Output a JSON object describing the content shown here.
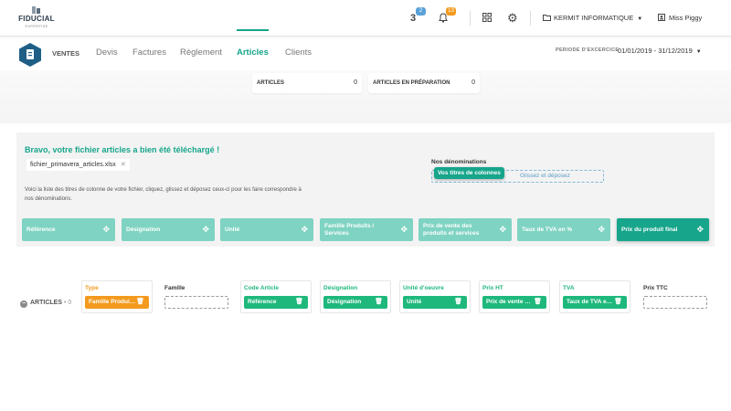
{
  "brand": {
    "name": "FIDUCIAL",
    "sub": "EXPERTISE"
  },
  "topbar": {
    "icons": [
      "bulk-icon",
      "bell-icon",
      "grid-icon",
      "gear-icon",
      "folder-icon",
      "user-icon"
    ],
    "badge_bulk": "2",
    "badge_bell": "13",
    "badge_bulk_color": "#5aa2d8",
    "badge_bell_color": "#f39a1e",
    "company": "KERMIT INFORMATIQUE",
    "user": "Miss Piggy"
  },
  "nav": {
    "module": "VENTES",
    "tabs": [
      {
        "label": "Devis",
        "active": false
      },
      {
        "label": "Factures",
        "active": false
      },
      {
        "label": "Règlement",
        "active": false
      },
      {
        "label": "Articles",
        "active": true
      },
      {
        "label": "Clients",
        "active": false
      }
    ],
    "period_label": "PERIODE D'EXCERCICE",
    "period_value": "01/01/2019 - 31/12/2019"
  },
  "counters": [
    {
      "label": "ARTICLES",
      "value": "0"
    },
    {
      "label": "ARTICLES EN PRÉPARATION",
      "value": "0"
    }
  ],
  "upload": {
    "success": "Bravo, votre fichier articles a bien été téléchargé !",
    "filename": "fichier_primavera_articles.xlsx",
    "help": "Voici la liste des titres de colonne de votre fichier, cliquez, glissez et déposez ceux-ci  pour les faire correspondre à nos dénominations.",
    "denominations_title": "Nos dénominations",
    "dropzone_text": "Glissez et déposez",
    "drag_chip": "Vos titres de colonnes",
    "columns": [
      "Référence",
      "Désignation",
      "Unité",
      "Famille Produits / Services",
      "Prix de vente des produits et services",
      "Taux de TVA en %",
      "Prix du produit final"
    ]
  },
  "mapping": {
    "row_label": "ARTICLES",
    "row_count": "• 0",
    "columns": [
      {
        "title": "Type",
        "chip": "Famille Produits / Services",
        "color": "#f39a1e"
      },
      {
        "title": "Famille",
        "chip": null,
        "color": "#333333"
      },
      {
        "title": "Code Article",
        "chip": "Référence",
        "color": "#1fb87c"
      },
      {
        "title": "Désignation",
        "chip": "Désignation",
        "color": "#1fb87c"
      },
      {
        "title": "Unité d'oeuvre",
        "chip": "Unité",
        "color": "#1fb87c"
      },
      {
        "title": "Prix HT",
        "chip": "Prix de vente des produits et services",
        "color": "#1fb87c"
      },
      {
        "title": "TVA",
        "chip": "Taux de TVA en %",
        "color": "#1fb87c"
      },
      {
        "title": "Prix TTC",
        "chip": null,
        "color": "#333333"
      }
    ]
  },
  "colors": {
    "accent": "#17a58b",
    "accent_light": "#7fd3c2",
    "orange": "#f39a1e",
    "green": "#1fb87c"
  }
}
